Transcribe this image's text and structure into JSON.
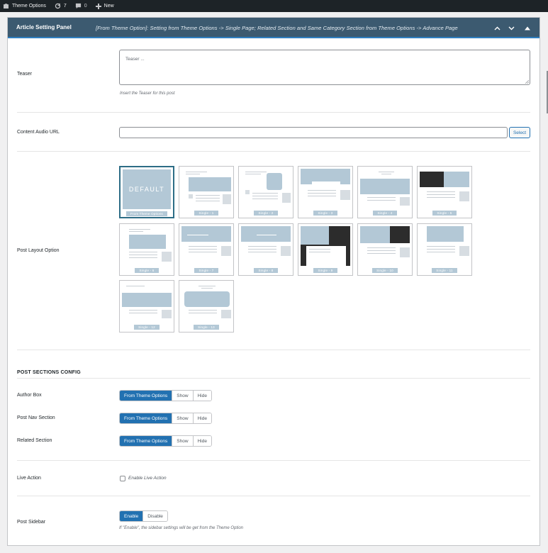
{
  "adminbar": {
    "site_name": "Theme Options",
    "updates_count": "7",
    "comments_count": "0",
    "new_label": "New"
  },
  "panel": {
    "title": "Article Setting Panel",
    "note": "[From Theme Option]: Setting from Theme Options -> Single Page; Related Section and Same Category Section from Theme Options -> Advance Page"
  },
  "teaser": {
    "label": "Teaser",
    "placeholder": "Teaser ...",
    "help": "Insert the Teaser for this post"
  },
  "audio": {
    "label": "Content Audio URL",
    "value": "",
    "select_label": "Select"
  },
  "layout": {
    "label": "Post Layout Option",
    "default_text": "DEFAULT",
    "selected": "From Theme Options",
    "options": [
      "From Theme Options",
      "Single - 1",
      "Single - 2",
      "Single - 3",
      "Single - 4",
      "Single - 5",
      "Single - 6",
      "Single - 7",
      "Single - 8",
      "Single - 9",
      "Single - 10",
      "Single - 11",
      "Single - 12",
      "Single - 13"
    ]
  },
  "sections": {
    "title": "POST SECTIONS CONFIG",
    "author_box": {
      "label": "Author Box",
      "options": [
        "From Theme Options",
        "Show",
        "Hide"
      ],
      "selected": "From Theme Options"
    },
    "post_nav": {
      "label": "Post Nav Section",
      "options": [
        "From Theme Options",
        "Show",
        "Hide"
      ],
      "selected": "From Theme Options"
    },
    "related": {
      "label": "Related Section",
      "options": [
        "From Theme Options",
        "Show",
        "Hide"
      ],
      "selected": "From Theme Options"
    }
  },
  "live_action": {
    "label": "Live Action",
    "checkbox_label": "Enable Live Action",
    "checked": false
  },
  "sidebar": {
    "label": "Post Sidebar",
    "options": [
      "Enable",
      "Disable"
    ],
    "selected": "Enable",
    "help": "If \"Enable\", the sidebar settings will be get from the Theme Option"
  },
  "colors": {
    "header_bg": "#3c5a70",
    "accent": "#2271b1",
    "thumb_blue": "#b3c8d6"
  }
}
